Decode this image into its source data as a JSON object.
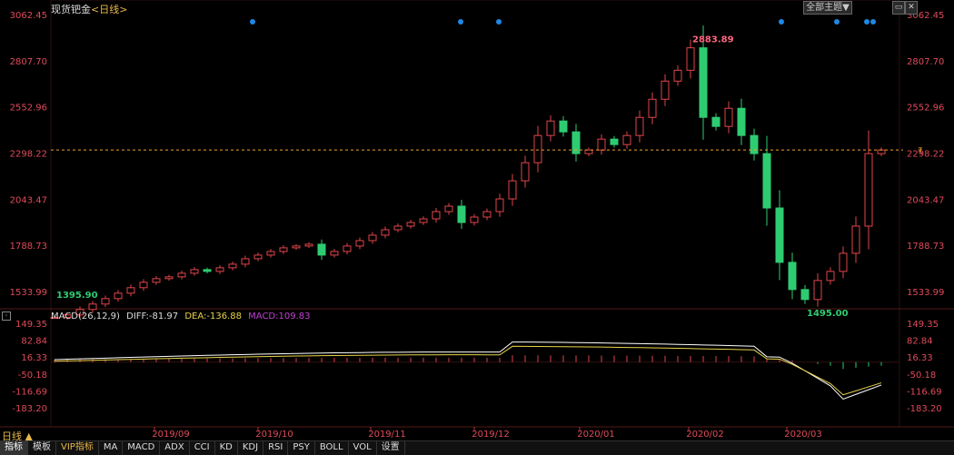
{
  "header": {
    "instrument": "现货钯金",
    "period_label": "<日线>",
    "theme_button": "全部主题▼",
    "window_buttons": [
      "▭",
      "✕"
    ]
  },
  "price_axis": {
    "labels": [
      "3062.45",
      "2807.70",
      "2552.96",
      "2298.22",
      "2043.47",
      "1788.73",
      "1533.99"
    ]
  },
  "macd_axis": {
    "labels": [
      "149.35",
      "82.84",
      "16.33",
      "-50.18",
      "-116.69",
      "-183.20"
    ]
  },
  "annotations": {
    "high_label": "2883.89",
    "low_label": "1495.00",
    "start_label": "1395.90",
    "current_price_marker": "₹"
  },
  "macd_legend": {
    "name": "MACD(26,12,9)",
    "diff": "DIFF:-81.97",
    "dea": "DEA:-136.88",
    "macd": "MACD:109.83"
  },
  "time_axis": {
    "labels": [
      "2019/09",
      "2019/10",
      "2019/11",
      "2019/12",
      "2020/01",
      "2020/02",
      "2020/03"
    ]
  },
  "period_tag": "日线 ▲",
  "bottom_tabs": [
    "指标",
    "模板",
    "VIP指标",
    "MA",
    "MACD",
    "ADX",
    "CCI",
    "KD",
    "KDJ",
    "RSI",
    "PSY",
    "BOLL",
    "VOL",
    "设置"
  ],
  "colors": {
    "up": "#e0454a",
    "down": "#2ecc71",
    "axis_text": "#e04a5a",
    "diff_line": "#ffffff",
    "dea_line": "#e8d44a",
    "macd_text": "#c040d0",
    "marker_dot": "#1e88e5",
    "current_line": "#f0a030"
  },
  "chart_data": {
    "type": "candlestick",
    "ylim": [
      1395.9,
      3062.45
    ],
    "x_ticks": [
      "2019/09",
      "2019/10",
      "2019/11",
      "2019/12",
      "2020/01",
      "2020/02",
      "2020/03"
    ],
    "close_series_approx": [
      1395.9,
      1410,
      1440,
      1470,
      1500,
      1530,
      1560,
      1590,
      1610,
      1620,
      1640,
      1660,
      1650,
      1670,
      1690,
      1720,
      1740,
      1760,
      1780,
      1790,
      1800,
      1740,
      1760,
      1790,
      1820,
      1850,
      1880,
      1900,
      1920,
      1940,
      1980,
      2010,
      1920,
      1950,
      1980,
      2050,
      2150,
      2250,
      2400,
      2480,
      2420,
      2300,
      2320,
      2380,
      2350,
      2400,
      2500,
      2600,
      2700,
      2760,
      2883.89,
      2500,
      2450,
      2550,
      2400,
      2300,
      2000,
      1700,
      1550,
      1495,
      1600,
      1650,
      1750,
      1900,
      2300,
      2320
    ],
    "high": 2883.89,
    "low": 1495.0,
    "macd_ylim": [
      -183.2,
      149.35
    ]
  }
}
